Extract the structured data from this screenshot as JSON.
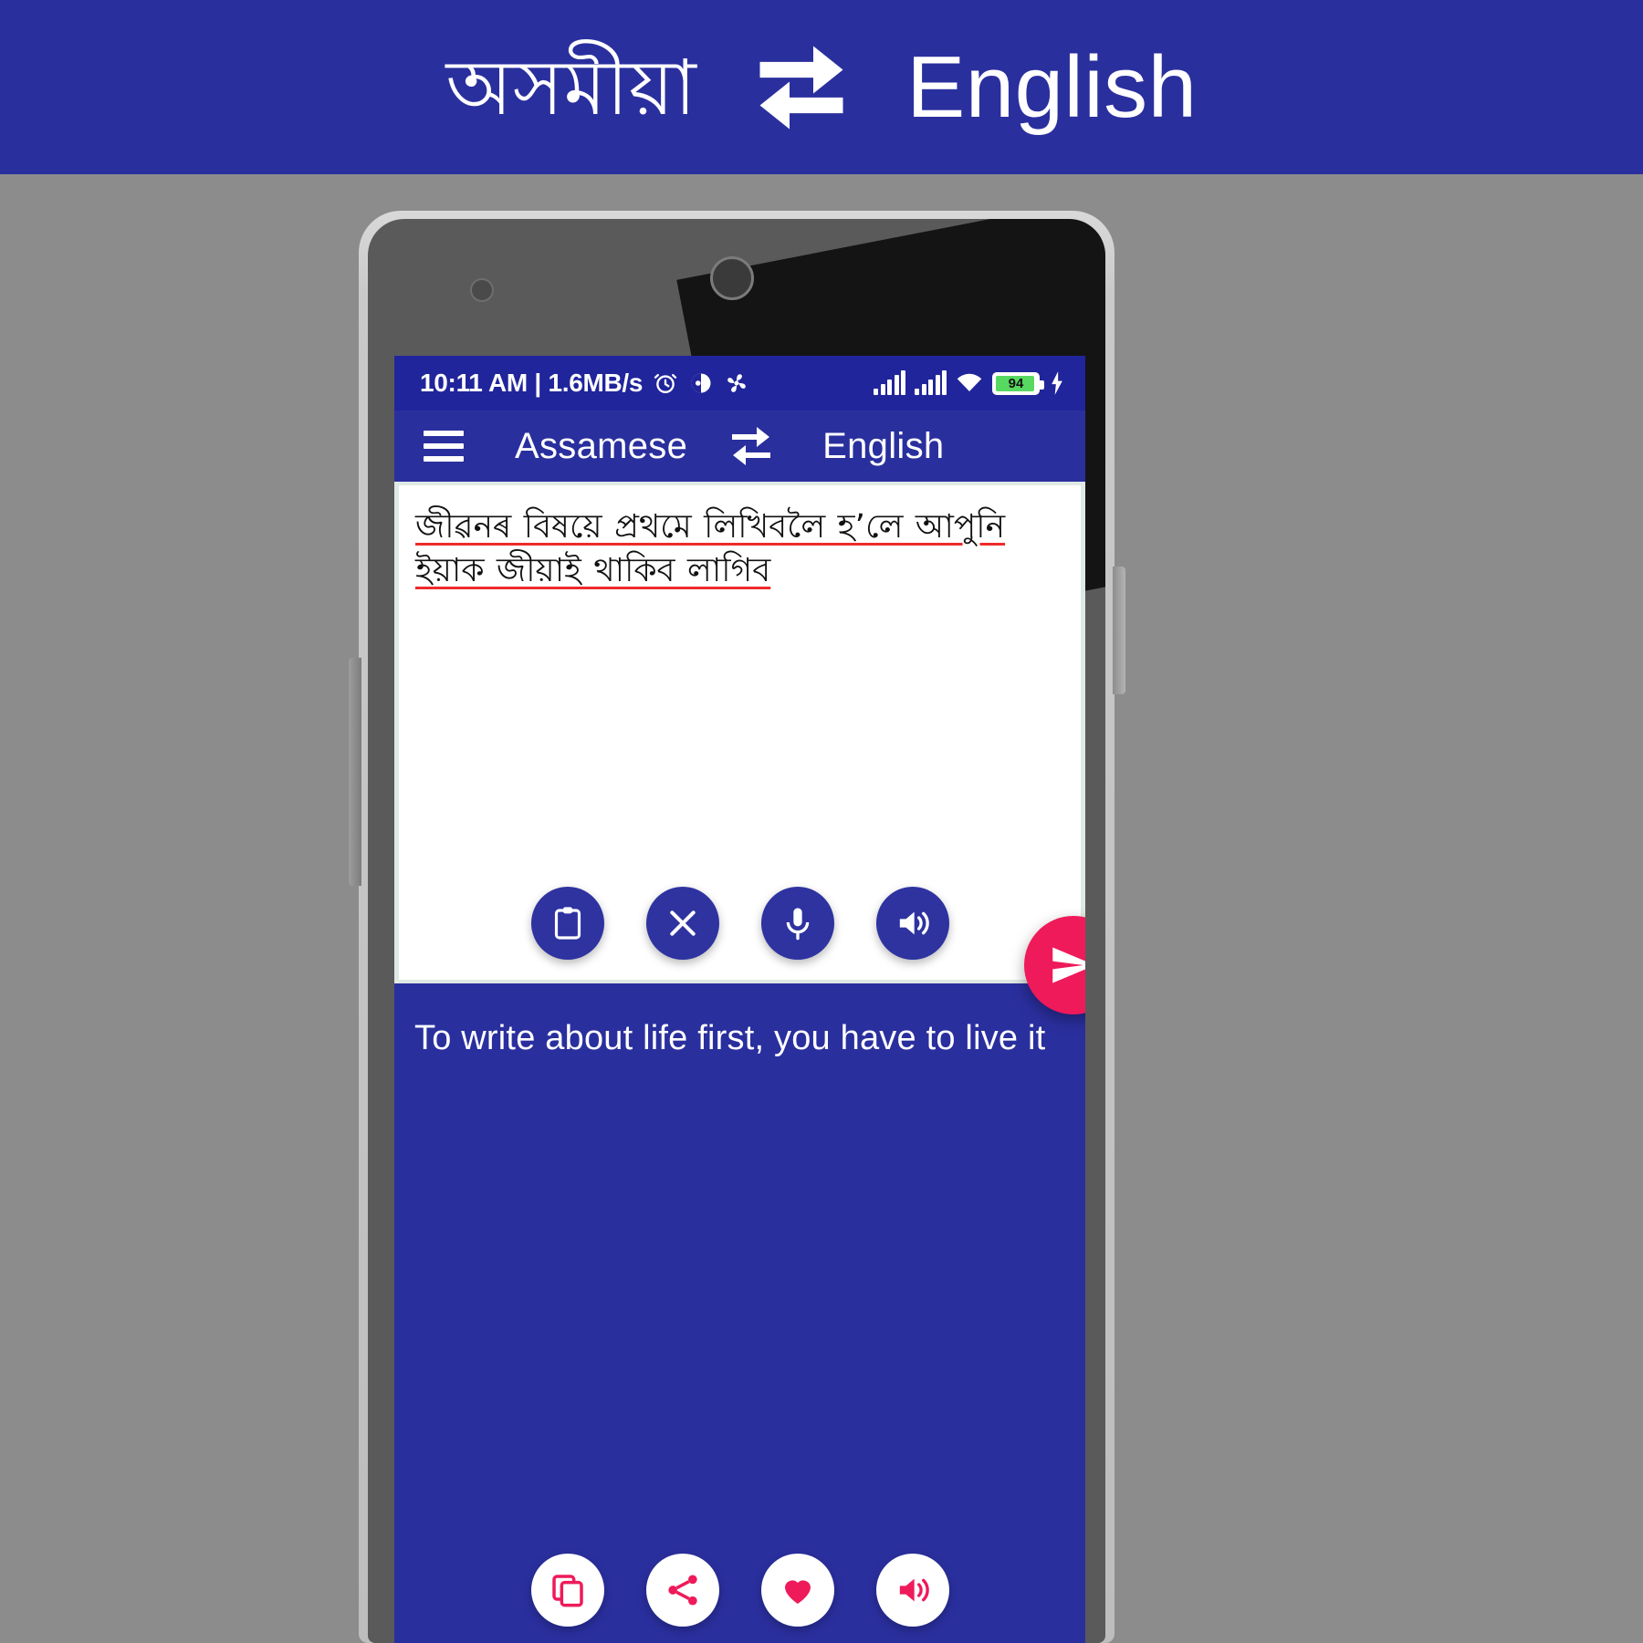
{
  "promo": {
    "source_language": "অসমীয়া",
    "swap_icon": "swap-horizontal-icon",
    "target_language": "English"
  },
  "phone": {
    "status_bar": {
      "time_and_speed": "10:11 AM | 1.6MB/s",
      "alarm_icon": "alarm-clock-icon",
      "brightness_icon": "brightness-icon",
      "fan_icon": "fan-icon",
      "signal_icon_1": "signal-bars-icon",
      "signal_icon_2": "signal-bars-icon",
      "wifi_icon": "wifi-icon",
      "battery_level": "94",
      "charging_icon": "lightning-bolt-icon",
      "background_color": "#21259b"
    },
    "app_bar": {
      "menu_icon": "hamburger-menu-icon",
      "source_language": "Assamese",
      "swap_icon": "swap-horizontal-icon",
      "target_language": "English",
      "background_color": "#2a2f9e"
    },
    "source_card": {
      "text": "জীৱনৰ বিষয়ে প্ৰথমে লিখিবলৈ হ’লে আপুনি ইয়াক জীয়াই থাকিব লাগিব",
      "spellcheck_underline_color": "#ef2a2a",
      "actions": [
        {
          "name": "paste-button",
          "icon": "clipboard-icon",
          "label": "Paste"
        },
        {
          "name": "clear-button",
          "icon": "close-x-icon",
          "label": "Clear"
        },
        {
          "name": "mic-button",
          "icon": "microphone-icon",
          "label": "Speak"
        },
        {
          "name": "speak-source-button",
          "icon": "speaker-volume-icon",
          "label": "Listen"
        }
      ]
    },
    "send_button": {
      "icon": "send-paper-plane-icon",
      "label": "Translate",
      "color": "#ef1a5a"
    },
    "result_panel": {
      "text": "To write about life first, you have to live it",
      "background_color": "#2a2f9e",
      "actions": [
        {
          "name": "copy-button",
          "icon": "copy-icon",
          "label": "Copy"
        },
        {
          "name": "share-button",
          "icon": "share-icon",
          "label": "Share"
        },
        {
          "name": "favorite-button",
          "icon": "heart-icon",
          "label": "Favorite"
        },
        {
          "name": "speak-result-button",
          "icon": "speaker-volume-icon",
          "label": "Listen"
        }
      ],
      "icon_color": "#ef1a5a"
    }
  }
}
